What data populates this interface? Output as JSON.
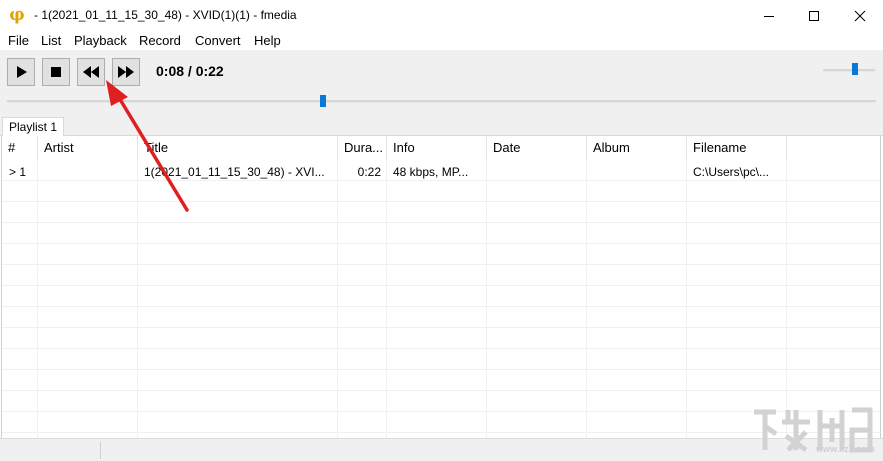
{
  "window": {
    "title": " - 1(2021_01_11_15_30_48) - XVID(1)(1) - fmedia",
    "app_icon": "phi-logo-icon",
    "app_icon_glyph": "φ"
  },
  "menu": {
    "items": [
      "File",
      "List",
      "Playback",
      "Record",
      "Convert",
      "Help"
    ]
  },
  "toolbar": {
    "buttons": [
      "play-icon",
      "stop-icon",
      "rewind-icon",
      "fast-forward-icon"
    ],
    "time_display": "0:08 / 0:22",
    "seek_position": 0.364,
    "volume_level": 0.62
  },
  "tabs": [
    {
      "label": "Playlist 1",
      "active": true
    }
  ],
  "playlist": {
    "columns": [
      "#",
      "Artist",
      "Title",
      "Dura...",
      "Info",
      "Date",
      "Album",
      "Filename"
    ],
    "rows": [
      {
        "num": "> 1",
        "artist": "",
        "title": "1(2021_01_11_15_30_48) - XVI...",
        "duration": "0:22",
        "info": "48 kbps, MP...",
        "date": "",
        "album": "",
        "filename": "C:\\Users\\pc\\..."
      }
    ]
  },
  "colors": {
    "accent": "#0a78d7",
    "annotation": "#e02020",
    "app_icon": "#e0a400"
  }
}
